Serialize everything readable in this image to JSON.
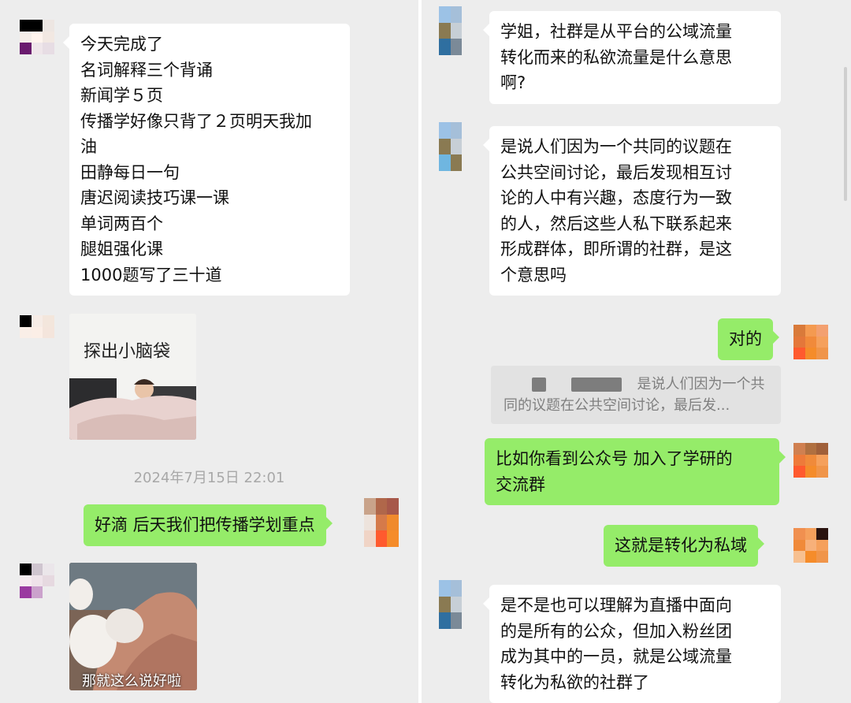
{
  "left": {
    "messages": {
      "todo_list": [
        "今天完成了",
        "名词解释三个背诵",
        "新闻学５页",
        "传播学好像只背了２页明天我加",
        "油",
        "田静每日一句",
        "唐迟阅读技巧课一课",
        "单词两百个",
        "腿姐强化课",
        "1000题写了三十道"
      ],
      "sticker_caption": "探出小脑袋",
      "timestamp": "2024年7月15日 22:01",
      "reply_out": "好滴 后天我们把传播学划重点",
      "photo_caption": "那就这么说好啦"
    }
  },
  "right": {
    "messages": {
      "question_1": [
        "学姐，社群是从平台的公域流量",
        "转化而来的私欲流量是什么意思",
        "啊?"
      ],
      "explain_1": [
        "是说人们因为一个共同的议题在",
        "公共空间讨论，最后发现相互讨",
        "论的人中有兴趣，态度行为一致",
        "的人，然后这些人私下联系起来",
        "形成群体，即所谓的社群，是这",
        "个意思吗"
      ],
      "reply_correct": "对的",
      "quote": {
        "line1": "是说人们因为一个共",
        "line2": "同的议题在公共空间讨论，最后发..."
      },
      "example": [
        "比如你看到公众号 加入了学研的",
        "交流群"
      ],
      "private_domain": "这就是转化为私域",
      "question_2": [
        "是不是也可以理解为直播中面向",
        "的是所有的公众，但加入粉丝团",
        "成为其中的一员，就是公域流量",
        "转化为私欲的社群了"
      ]
    }
  },
  "colors": {
    "chat_bg": "#ededed",
    "incoming_bubble": "#ffffff",
    "outgoing_bubble": "#95ec69",
    "timestamp_text": "#a8a8a8"
  }
}
